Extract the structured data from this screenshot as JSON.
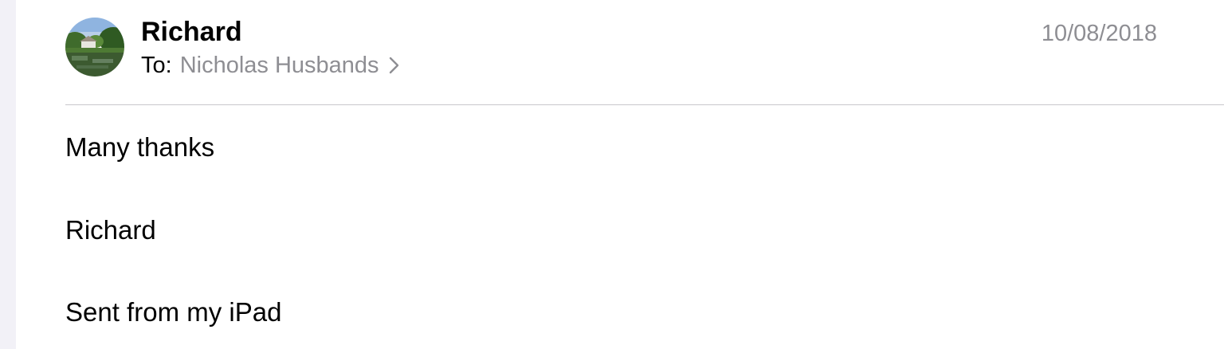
{
  "message": {
    "sender": "Richard",
    "to_label": "To:",
    "recipient": "Nicholas Husbands",
    "date": "10/08/2018",
    "body": [
      "Many thanks",
      "Richard",
      "Sent from my iPad"
    ]
  },
  "icons": {
    "avatar": "contact-photo",
    "recipient_chevron": "chevron-right-icon"
  },
  "colors": {
    "background": "#f2f1f7",
    "pane": "#ffffff",
    "secondary_text": "#8e8e93",
    "divider": "#c8c7cc"
  }
}
